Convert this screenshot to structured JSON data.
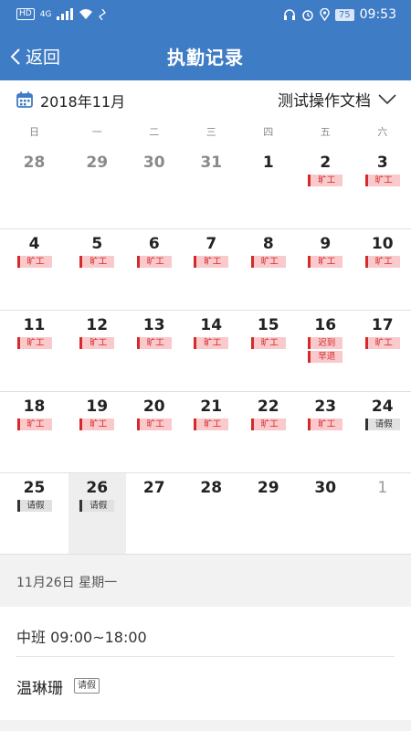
{
  "status_bar": {
    "hd": "HD",
    "network": "4G",
    "battery": "75",
    "time": "09:53"
  },
  "nav": {
    "back_label": "返回",
    "title": "执勤记录"
  },
  "month_bar": {
    "month_label": "2018年11月",
    "document_label": "测试操作文档"
  },
  "weekdays": [
    "日",
    "一",
    "二",
    "三",
    "四",
    "五",
    "六"
  ],
  "weeks": [
    [
      {
        "day": "28",
        "kind": "other",
        "tags": []
      },
      {
        "day": "29",
        "kind": "other",
        "tags": []
      },
      {
        "day": "30",
        "kind": "other",
        "tags": []
      },
      {
        "day": "31",
        "kind": "other",
        "tags": []
      },
      {
        "day": "1",
        "kind": "current",
        "tags": []
      },
      {
        "day": "2",
        "kind": "current",
        "tags": [
          {
            "text": "旷工",
            "color": "red"
          }
        ]
      },
      {
        "day": "3",
        "kind": "current",
        "tags": [
          {
            "text": "旷工",
            "color": "red"
          }
        ]
      }
    ],
    [
      {
        "day": "4",
        "kind": "current",
        "tags": [
          {
            "text": "旷工",
            "color": "red"
          }
        ]
      },
      {
        "day": "5",
        "kind": "current",
        "tags": [
          {
            "text": "旷工",
            "color": "red"
          }
        ]
      },
      {
        "day": "6",
        "kind": "current",
        "tags": [
          {
            "text": "旷工",
            "color": "red"
          }
        ]
      },
      {
        "day": "7",
        "kind": "current",
        "tags": [
          {
            "text": "旷工",
            "color": "red"
          }
        ]
      },
      {
        "day": "8",
        "kind": "current",
        "tags": [
          {
            "text": "旷工",
            "color": "red"
          }
        ]
      },
      {
        "day": "9",
        "kind": "current",
        "tags": [
          {
            "text": "旷工",
            "color": "red"
          }
        ]
      },
      {
        "day": "10",
        "kind": "current",
        "tags": [
          {
            "text": "旷工",
            "color": "red"
          }
        ]
      }
    ],
    [
      {
        "day": "11",
        "kind": "current",
        "tags": [
          {
            "text": "旷工",
            "color": "red"
          }
        ]
      },
      {
        "day": "12",
        "kind": "current",
        "tags": [
          {
            "text": "旷工",
            "color": "red"
          }
        ]
      },
      {
        "day": "13",
        "kind": "current",
        "tags": [
          {
            "text": "旷工",
            "color": "red"
          }
        ]
      },
      {
        "day": "14",
        "kind": "current",
        "tags": [
          {
            "text": "旷工",
            "color": "red"
          }
        ]
      },
      {
        "day": "15",
        "kind": "current",
        "tags": [
          {
            "text": "旷工",
            "color": "red"
          }
        ]
      },
      {
        "day": "16",
        "kind": "current",
        "tags": [
          {
            "text": "迟到",
            "color": "red"
          },
          {
            "text": "早退",
            "color": "red"
          }
        ]
      },
      {
        "day": "17",
        "kind": "current",
        "tags": [
          {
            "text": "旷工",
            "color": "red"
          }
        ]
      }
    ],
    [
      {
        "day": "18",
        "kind": "current",
        "tags": [
          {
            "text": "旷工",
            "color": "red"
          }
        ]
      },
      {
        "day": "19",
        "kind": "current",
        "tags": [
          {
            "text": "旷工",
            "color": "red"
          }
        ]
      },
      {
        "day": "20",
        "kind": "current",
        "tags": [
          {
            "text": "旷工",
            "color": "red"
          }
        ]
      },
      {
        "day": "21",
        "kind": "current",
        "tags": [
          {
            "text": "旷工",
            "color": "red"
          }
        ]
      },
      {
        "day": "22",
        "kind": "current",
        "tags": [
          {
            "text": "旷工",
            "color": "red"
          }
        ]
      },
      {
        "day": "23",
        "kind": "current",
        "tags": [
          {
            "text": "旷工",
            "color": "red"
          }
        ]
      },
      {
        "day": "24",
        "kind": "current",
        "tags": [
          {
            "text": "请假",
            "color": "gray"
          }
        ]
      }
    ],
    [
      {
        "day": "25",
        "kind": "current",
        "tags": [
          {
            "text": "请假",
            "color": "gray"
          }
        ]
      },
      {
        "day": "26",
        "kind": "selected",
        "tags": [
          {
            "text": "请假",
            "color": "gray"
          }
        ]
      },
      {
        "day": "27",
        "kind": "current",
        "tags": []
      },
      {
        "day": "28",
        "kind": "current",
        "tags": []
      },
      {
        "day": "29",
        "kind": "current",
        "tags": []
      },
      {
        "day": "30",
        "kind": "current",
        "tags": []
      },
      {
        "day": "1",
        "kind": "next",
        "tags": []
      }
    ]
  ],
  "selected_date": "11月26日 星期一",
  "detail": {
    "shift": "中班 09:00~18:00",
    "person_name": "温琳珊",
    "leave_badge": "请假"
  },
  "colors": {
    "primary": "#3f7cc6",
    "absent_red": "#d42a2a",
    "absent_bg": "#f9c9cb",
    "leave_gray": "#e1e1e1"
  }
}
